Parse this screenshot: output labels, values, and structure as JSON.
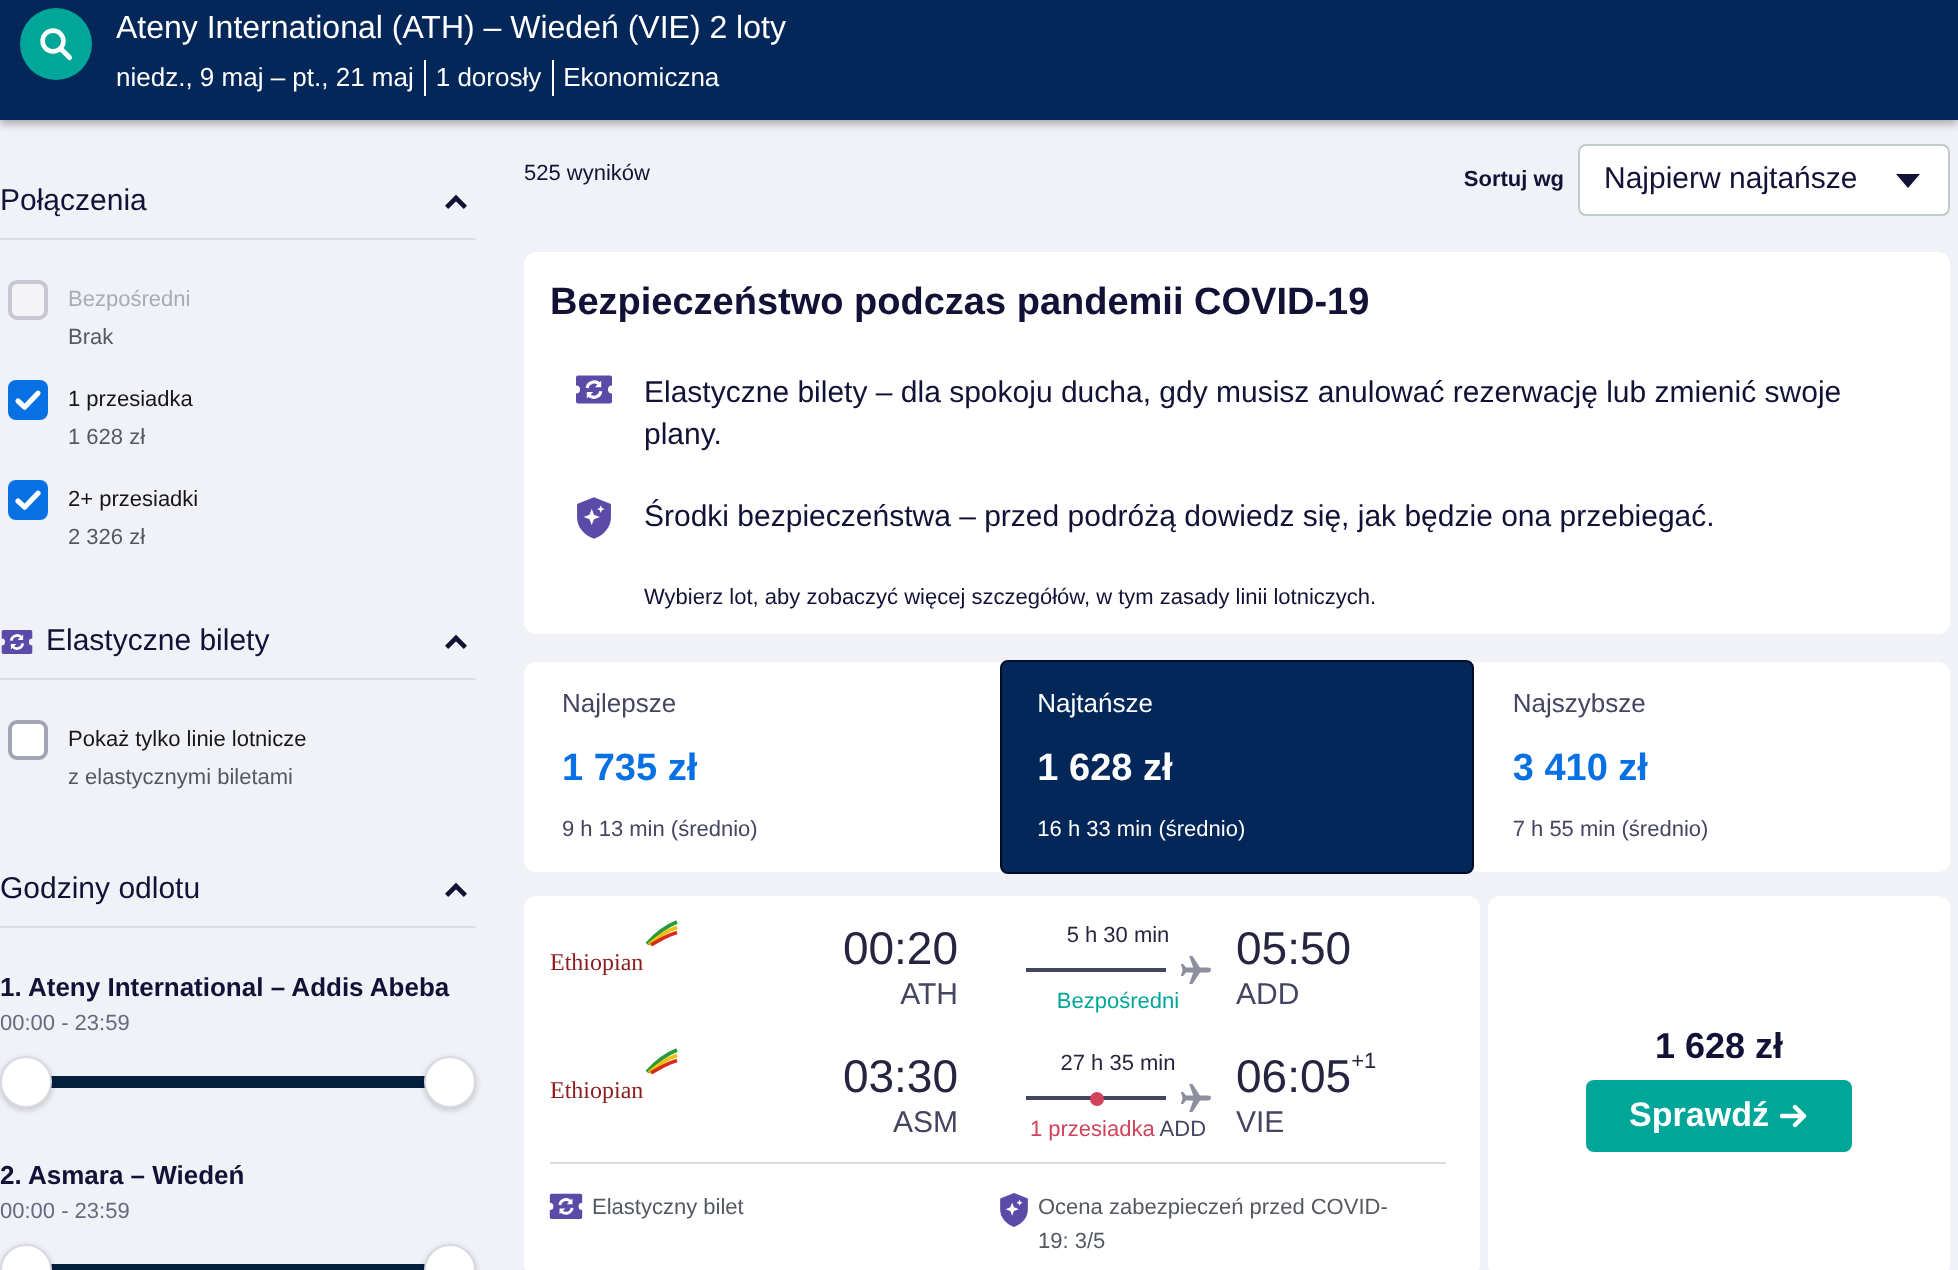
{
  "header": {
    "title": "Ateny International (ATH) – Wiedeń (VIE) 2 loty",
    "details": [
      "niedz., 9 maj – pt., 21 maj",
      "1 dorosły",
      "Ekonomiczna"
    ]
  },
  "filters": [
    {
      "kind": "stops",
      "title": "Połączenia",
      "expanded": true,
      "options": [
        {
          "label": "Bezpośredni",
          "sub": "Brak",
          "checked": false,
          "disabled": true
        },
        {
          "label": "1 przesiadka",
          "sub": "1 628 zł",
          "checked": true,
          "disabled": false
        },
        {
          "label": "2+ przesiadki",
          "sub": "2 326 zł",
          "checked": true,
          "disabled": false
        }
      ]
    },
    {
      "kind": "flexible",
      "title": "Elastyczne bilety",
      "expanded": true,
      "options": [
        {
          "label": "Pokaż tylko linie lotnicze",
          "sub": "z elastycznymi biletami",
          "checked": false,
          "disabled": false
        }
      ]
    },
    {
      "kind": "times",
      "title": "Godziny odlotu",
      "expanded": true,
      "slots": [
        {
          "label": "1. Ateny International – Addis Abeba",
          "range": "00:00 - 23:59",
          "level": 1
        },
        {
          "label": "2. Asmara – Wiedeń",
          "range": "00:00 - 23:59",
          "level": 1
        }
      ]
    }
  ],
  "results": {
    "count": "525 wyników",
    "sort": {
      "label": "Sortuj wg",
      "value": "Najpierw najtańsze"
    }
  },
  "covid_notice": {
    "title": "Bezpieczeństwo podczas pandemii COVID-19",
    "items": [
      {
        "kind": "flexible",
        "text": "Elastyczne bilety – dla spokoju ducha, gdy musisz anulować rezerwację lub zmienić swoje plany."
      },
      {
        "kind": "safety",
        "text": "Środki bezpieczeństwa – przed podróżą dowiedz się, jak będzie ona przebiegać."
      }
    ],
    "note": "Wybierz lot, aby zobaczyć więcej szczegółów, w tym zasady linii lotniczych."
  },
  "sort_tabs": [
    {
      "label": "Najlepsze",
      "price": "1 735 zł",
      "duration": "9 h 13 min (średnio)",
      "selected": false
    },
    {
      "label": "Najtańsze",
      "price": "1 628 zł",
      "duration": "16 h 33 min (średnio)",
      "selected": true
    },
    {
      "label": "Najszybsze",
      "price": "3 410 zł",
      "duration": "7 h 55 min (średnio)",
      "selected": false
    }
  ],
  "flights": [
    {
      "legs": [
        {
          "airline": "Ethiopian",
          "depart_time": "00:20",
          "depart_code": "ATH",
          "duration": "5 h 30 min",
          "kind": "direct",
          "stops_label": "Bezpośredni",
          "arrive_time": "05:50",
          "arrive_code": "ADD"
        },
        {
          "airline": "Ethiopian",
          "depart_time": "03:30",
          "depart_code": "ASM",
          "duration": "27 h 35 min",
          "kind": "connection",
          "stops_label": "1 przesiadka",
          "via": [
            "ADD"
          ],
          "arrive_time": "06:05",
          "day_offset": "+1",
          "arrive_code": "VIE"
        }
      ],
      "features": [
        {
          "kind": "flexible",
          "text": "Elastyczny bilet"
        },
        {
          "kind": "safety",
          "text": "Ocena zabezpieczeń przed COVID-19: 3/5"
        }
      ],
      "price": "1 628 zł",
      "action": "Sprawdź"
    }
  ]
}
